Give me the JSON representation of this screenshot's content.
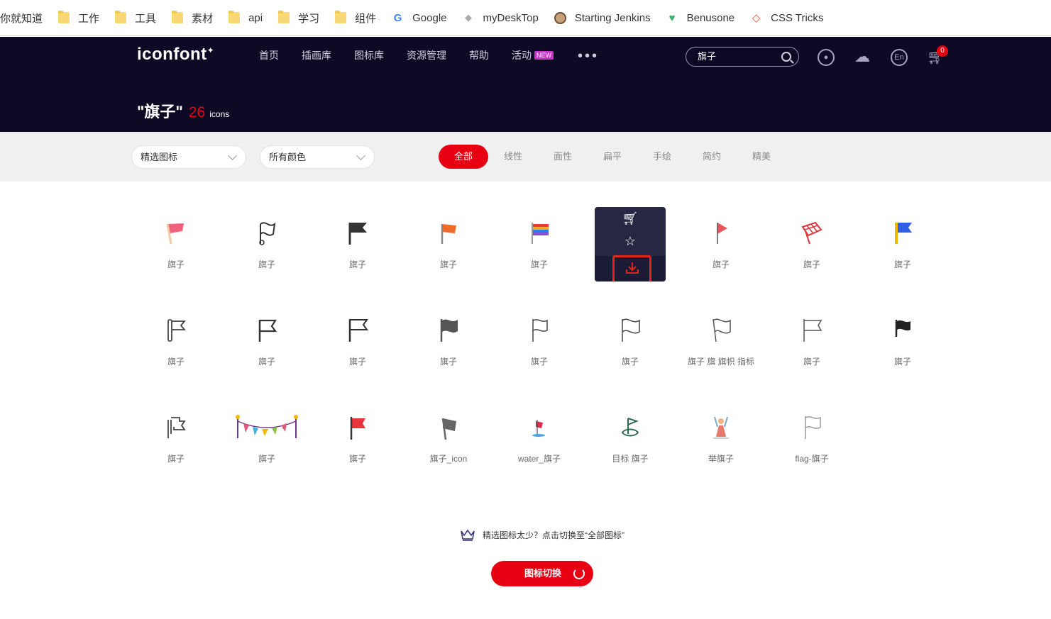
{
  "bookmarks": [
    {
      "label": "你就知道",
      "icon": "folder-icon"
    },
    {
      "label": "工作",
      "icon": "folder-icon"
    },
    {
      "label": "工具",
      "icon": "folder-icon"
    },
    {
      "label": "素材",
      "icon": "folder-icon"
    },
    {
      "label": "api",
      "icon": "folder-icon"
    },
    {
      "label": "学习",
      "icon": "folder-icon"
    },
    {
      "label": "组件",
      "icon": "folder-icon"
    },
    {
      "label": "Google",
      "icon": "google-icon"
    },
    {
      "label": "myDeskTop",
      "icon": "mydesktop-icon"
    },
    {
      "label": "Starting Jenkins",
      "icon": "jenkins-icon"
    },
    {
      "label": "Benusone",
      "icon": "benusone-icon"
    },
    {
      "label": "CSS Tricks",
      "icon": "css-tricks-icon"
    }
  ],
  "header": {
    "logo": "iconfont",
    "nav": [
      "首页",
      "插画库",
      "图标库",
      "资源管理",
      "帮助",
      "活动"
    ],
    "nav_new_badge": "NEW",
    "search_value": "旗子",
    "cart_count": "0",
    "lang_label": "En",
    "result_query": "\"旗子\"",
    "result_count": "26",
    "result_unit": "icons"
  },
  "filters": {
    "select1": "精选图标",
    "select2": "所有颜色",
    "tabs": [
      "全部",
      "线性",
      "面性",
      "扁平",
      "手绘",
      "简约",
      "精美"
    ],
    "active_tab": "全部"
  },
  "icons": [
    [
      "旗子",
      "旗子",
      "旗子",
      "旗子",
      "旗子",
      "",
      "旗子",
      "旗子",
      "旗子"
    ],
    [
      "旗子",
      "旗子",
      "旗子",
      "旗子",
      "旗子",
      "旗子",
      "旗子 旗 旗帜 指标",
      "旗子",
      "旗子"
    ],
    [
      "旗子",
      "旗子",
      "旗子",
      "旗子_icon",
      "water_旗子",
      "目标 旗子",
      "举旗子",
      "flag-旗子"
    ]
  ],
  "footer": {
    "tip": "精选图标太少？点击切换至“全部图标”",
    "switch_label": "图标切换"
  },
  "colors": {
    "accent": "#e60012",
    "header_bg": "#0e0a26"
  }
}
